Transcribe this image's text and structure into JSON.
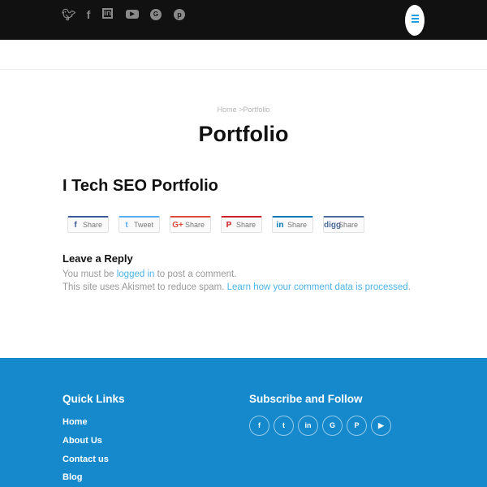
{
  "header": {
    "social_icons": [
      "twitter-icon",
      "facebook-icon",
      "linkedin-icon",
      "youtube-icon",
      "google-plus-icon",
      "pinterest-icon"
    ],
    "menu_icon": "hamburger-icon"
  },
  "breadcrumb": {
    "home": "Home",
    "separator": ">",
    "current": "Portfolio"
  },
  "page_title": "Portfolio",
  "post_title": "I Tech SEO Portfolio",
  "share_buttons": [
    {
      "icon": "f",
      "label": "Share",
      "color": "#3b5998"
    },
    {
      "icon": "t",
      "label": "Tweet",
      "color": "#55acee"
    },
    {
      "icon": "G+",
      "label": "Share",
      "color": "#dd4b39"
    },
    {
      "icon": "P",
      "label": "Share",
      "color": "#cb2027"
    },
    {
      "icon": "in",
      "label": "Share",
      "color": "#0077b5"
    },
    {
      "icon": "digg",
      "label": "Share",
      "color": "#4a6a9a"
    }
  ],
  "comments": {
    "heading": "Leave a Reply",
    "line1_pre": "You must be ",
    "line1_link": "logged in",
    "line1_post": " to post a comment.",
    "line2_pre": "This site uses Akismet to reduce spam. ",
    "line2_link": "Learn how your comment data is processed",
    "line2_post": "."
  },
  "footer": {
    "quick_links_title": "Quick Links",
    "links": [
      "Home",
      "About Us",
      "Contact us",
      "Blog"
    ],
    "subscribe_title": "Subscribe and Follow",
    "social_icons": [
      "facebook-icon",
      "twitter-icon",
      "linkedin-icon",
      "google-plus-icon",
      "pinterest-icon",
      "youtube-icon"
    ],
    "background": "#1589cc"
  }
}
